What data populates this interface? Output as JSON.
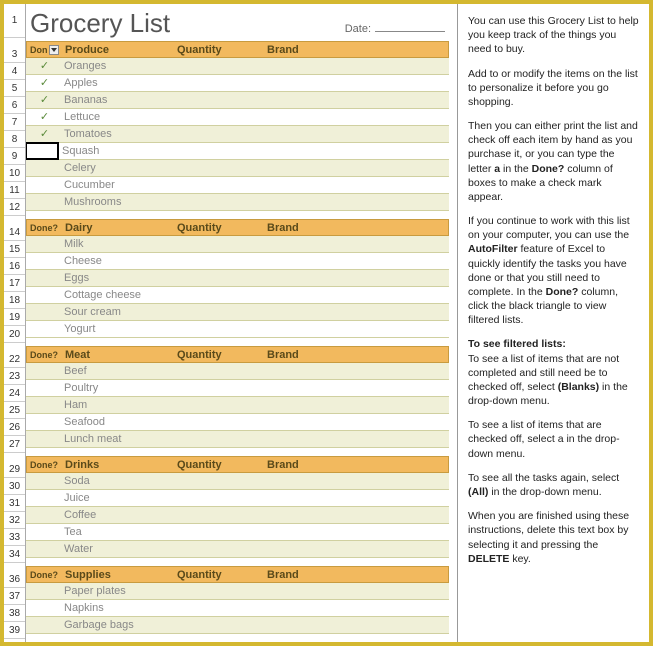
{
  "title": "Grocery List",
  "date_label": "Date:",
  "columns": {
    "done": "Don",
    "done_full": "Done?",
    "item": "",
    "qty": "Quantity",
    "brand": "Brand"
  },
  "sections": [
    {
      "name": "Produce",
      "filter": true,
      "rows": [
        {
          "done": "a",
          "item": "Oranges"
        },
        {
          "done": "a",
          "item": "Apples"
        },
        {
          "done": "a",
          "item": "Bananas"
        },
        {
          "done": "a",
          "item": "Lettuce"
        },
        {
          "done": "a",
          "item": "Tomatoes"
        },
        {
          "done": "",
          "item": "Squash",
          "selected": true
        },
        {
          "done": "",
          "item": "Celery"
        },
        {
          "done": "",
          "item": "Cucumber"
        },
        {
          "done": "",
          "item": "Mushrooms"
        }
      ]
    },
    {
      "name": "Dairy",
      "rows": [
        {
          "done": "",
          "item": "Milk"
        },
        {
          "done": "",
          "item": "Cheese"
        },
        {
          "done": "",
          "item": "Eggs"
        },
        {
          "done": "",
          "item": "Cottage cheese"
        },
        {
          "done": "",
          "item": "Sour cream"
        },
        {
          "done": "",
          "item": "Yogurt"
        }
      ]
    },
    {
      "name": "Meat",
      "rows": [
        {
          "done": "",
          "item": "Beef"
        },
        {
          "done": "",
          "item": "Poultry"
        },
        {
          "done": "",
          "item": "Ham"
        },
        {
          "done": "",
          "item": "Seafood"
        },
        {
          "done": "",
          "item": "Lunch meat"
        }
      ]
    },
    {
      "name": "Drinks",
      "rows": [
        {
          "done": "",
          "item": "Soda"
        },
        {
          "done": "",
          "item": "Juice"
        },
        {
          "done": "",
          "item": "Coffee"
        },
        {
          "done": "",
          "item": "Tea"
        },
        {
          "done": "",
          "item": "Water"
        }
      ]
    },
    {
      "name": "Supplies",
      "rows": [
        {
          "done": "",
          "item": "Paper plates"
        },
        {
          "done": "",
          "item": "Napkins"
        },
        {
          "done": "",
          "item": "Garbage bags"
        }
      ]
    }
  ],
  "rownums": [
    "1",
    "",
    "3",
    "4",
    "5",
    "6",
    "7",
    "8",
    "9",
    "10",
    "11",
    "12",
    "",
    "14",
    "15",
    "16",
    "17",
    "18",
    "19",
    "20",
    "",
    "22",
    "23",
    "24",
    "25",
    "26",
    "27",
    "",
    "29",
    "30",
    "31",
    "32",
    "33",
    "34",
    "",
    "36",
    "37",
    "38",
    "39"
  ],
  "help": {
    "p1": "You can use this Grocery List to help you keep track of the things you need to buy.",
    "p2": "Add to or modify the items on the list to personalize it before you go shopping.",
    "p3a": "Then you can either print the list and check off each item by hand as you purchase it, or you can type the letter ",
    "p3b": "a",
    "p3c": " in the ",
    "p3d": "Done?",
    "p3e": " column of boxes to make a check mark appear.",
    "p4a": "If you continue to work with this list on your computer, you can use the ",
    "p4b": "AutoFilter",
    "p4c": " feature of Excel to quickly identify the tasks you have done or that you still need to complete. In the ",
    "p4d": "Done?",
    "p4e": " column, click the black triangle to view filtered lists.",
    "p5a": "To see filtered lists:",
    "p5b": "To see a list of items that are not completed and still need be to checked off, select ",
    "p5c": "(Blanks)",
    "p5d": " in the drop-down menu.",
    "p6a": "To see a list of items that are checked off, select a in the drop-down menu.",
    "p7a": "To see all the tasks again, select ",
    "p7b": "(All)",
    "p7c": " in the drop-down menu.",
    "p8a": "When you are finished using these instructions, delete this text box by selecting it and pressing the ",
    "p8b": "DELETE",
    "p8c": " key."
  }
}
